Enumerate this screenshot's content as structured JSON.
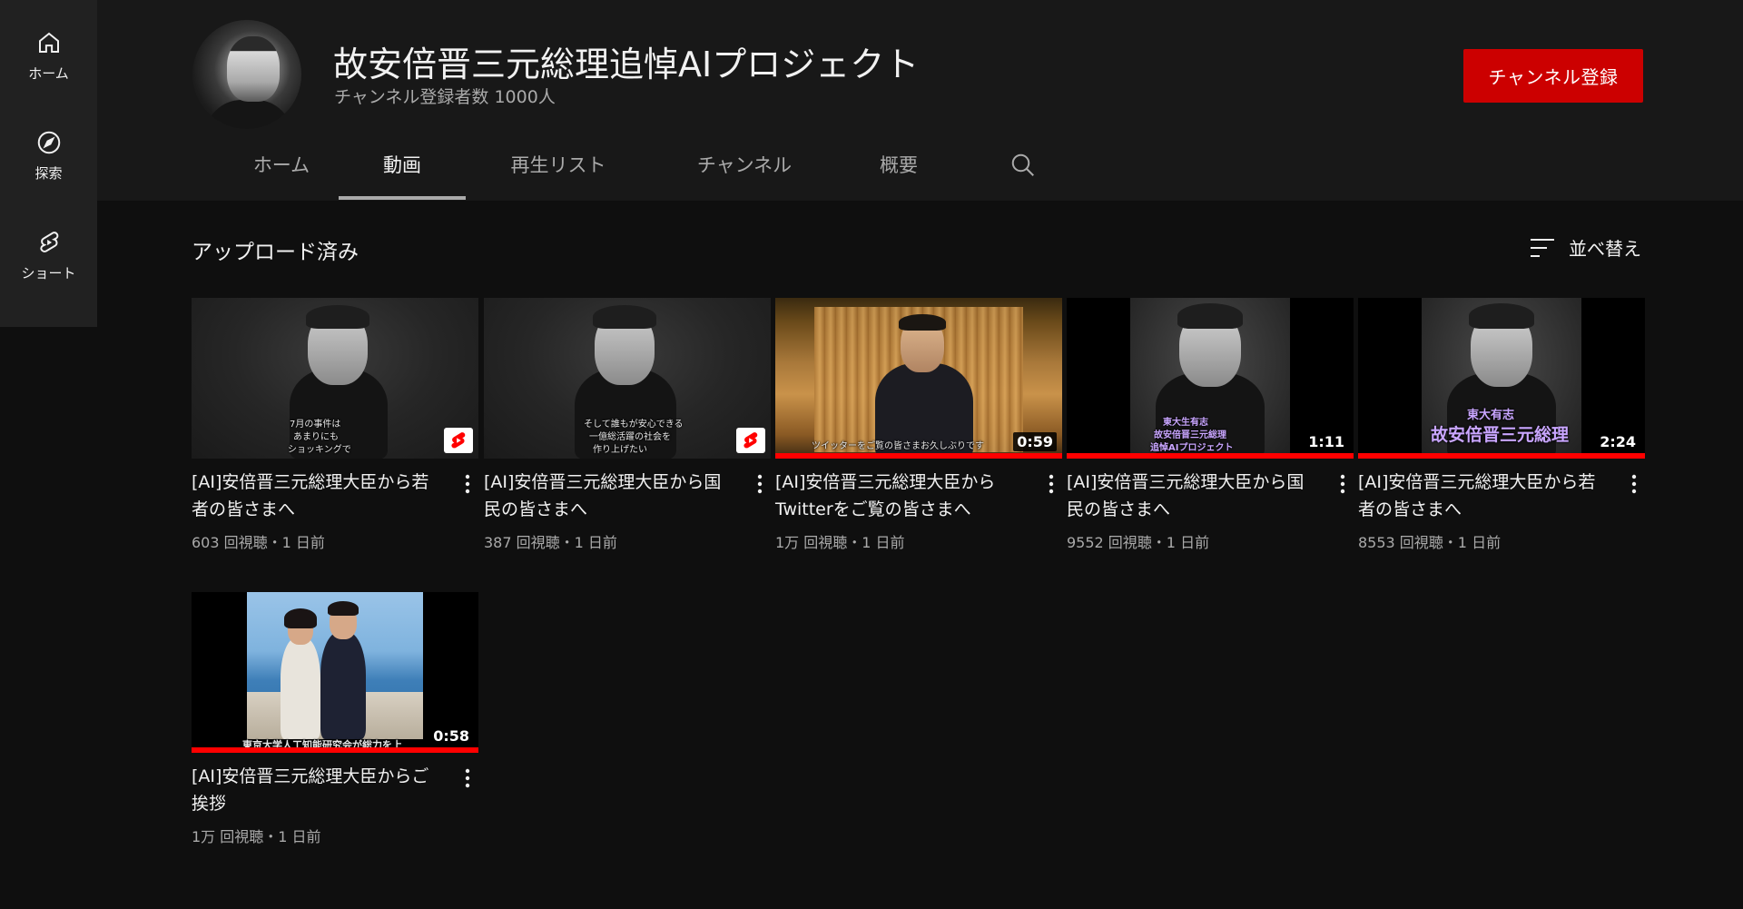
{
  "guide": {
    "items": [
      {
        "label": "ホーム",
        "icon": "home-icon"
      },
      {
        "label": "探索",
        "icon": "compass-icon"
      },
      {
        "label": "ショート",
        "icon": "shorts-icon"
      }
    ]
  },
  "channel": {
    "title": "故安倍晋三元総理追悼AIプロジェクト",
    "subscribers": "チャンネル登録者数 1000人",
    "subscribe_label": "チャンネル登録",
    "accent": "#cc0000"
  },
  "tabs": [
    "ホーム",
    "動画",
    "再生リスト",
    "チャンネル",
    "概要"
  ],
  "active_tab": "動画",
  "section": {
    "title": "アップロード済み",
    "sort_label": "並べ替え"
  },
  "videos": [
    {
      "title": "[AI]安倍晋三元総理大臣から若者の皆さまへ",
      "meta": "603 回視聴・1 日前",
      "badge": "shorts",
      "thumb_caption": [
        "7月の事件は",
        "あまりにも",
        "ショッキングで"
      ]
    },
    {
      "title": "[AI]安倍晋三元総理大臣から国民の皆さまへ",
      "meta": "387 回視聴・1 日前",
      "badge": "shorts",
      "thumb_caption": [
        "そして誰もが安心できる",
        "一億総活躍の社会を",
        "作り上げたい"
      ]
    },
    {
      "title": "[AI]安倍晋三元総理大臣からTwitterをご覧の皆さまへ",
      "meta": "1万 回視聴・1 日前",
      "duration": "0:59",
      "progress": 1.0,
      "thumb_caption": [
        "ツイッターをご覧の皆さまお久しぶりです"
      ]
    },
    {
      "title": "[AI]安倍晋三元総理大臣から国民の皆さまへ",
      "meta": "9552 回視聴・1 日前",
      "duration": "1:11",
      "progress": 1.0,
      "thumb_caption": [
        "東大生有志",
        "故安倍晋三元総理",
        "追悼AIプロジェクト"
      ]
    },
    {
      "title": "[AI]安倍晋三元総理大臣から若者の皆さまへ",
      "meta": "8553 回視聴・1 日前",
      "duration": "2:24",
      "progress": 1.0,
      "thumb_caption": [
        "東大有志",
        "故安倍晋三元総理"
      ]
    },
    {
      "title": "[AI]安倍晋三元総理大臣からご挨拶",
      "meta": "1万 回視聴・1 日前",
      "duration": "0:58",
      "progress": 1.0,
      "thumb_caption": [
        "東京大学人工知能研究会が総力を上"
      ]
    }
  ]
}
